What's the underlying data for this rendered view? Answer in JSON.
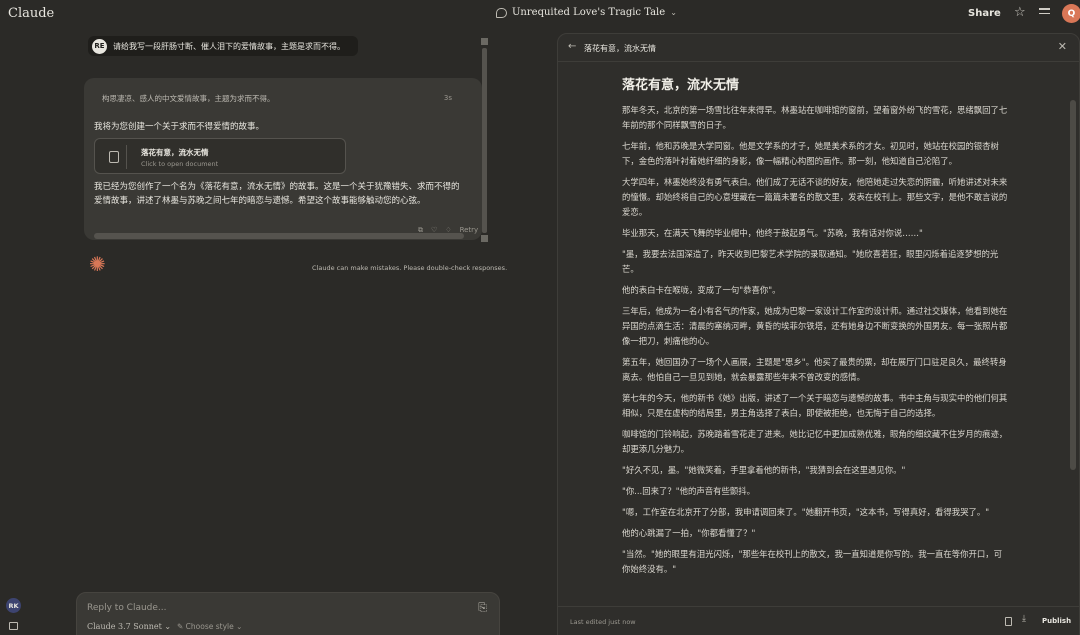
{
  "app": {
    "brand": "Claude"
  },
  "header": {
    "conversation_title": "Unrequited Love's Tragic Tale",
    "share_label": "Share",
    "user_initial": "Q"
  },
  "chat": {
    "user_initials": "RE",
    "user_message": "请给我写一段肝肠寸断、催人泪下的爱情故事，主题是求而不得。",
    "thinking_label": "构思凄凉、感人的中文爱情故事，主题为求而不得。",
    "thinking_time": "3s",
    "intro": "我将为您创建一个关于求而不得爱情的故事。",
    "artifact": {
      "title": "落花有意，流水无情",
      "subtitle": "Click to open document"
    },
    "summary": "我已经为您创作了一个名为《落花有意，流水无情》的故事。这是一个关于犹豫错失、求而不得的爱情故事，讲述了林墨与苏晚之间七年的暗恋与遗憾。希望这个故事能够触动您的心弦。",
    "actions": {
      "retry": "Retry"
    },
    "disclaimer": "Claude can make mistakes. Please double-check responses."
  },
  "composer": {
    "placeholder": "Reply to Claude...",
    "model": "Claude 3.7 Sonnet",
    "style": "Choose style"
  },
  "sidebar": {
    "user_initials": "RK"
  },
  "artifact_panel": {
    "header_title": "落花有意，流水无情",
    "doc_title": "落花有意，流水无情",
    "paragraphs": [
      "那年冬天，北京的第一场雪比往年来得早。林墨站在咖啡馆的窗前，望着窗外纷飞的雪花，思绪飘回了七年前的那个同样飘雪的日子。",
      "七年前，他和苏晚是大学同窗。他是文学系的才子，她是美术系的才女。初见时，她站在校园的银杏树下，金色的落叶衬着她纤细的身影，像一幅精心构图的画作。那一刻，他知道自己沦陷了。",
      "大学四年，林墨始终没有勇气表白。他们成了无话不谈的好友，他陪她走过失恋的阴霾，听她讲述对未来的憧憬。却始终将自己的心意埋藏在一篇篇未署名的散文里，发表在校刊上。那些文字，是他不敢言说的爱恋。",
      "毕业那天，在满天飞舞的毕业帽中，他终于鼓起勇气。\"苏晚，我有话对你说……\"",
      "\"墨，我要去法国深造了，昨天收到巴黎艺术学院的录取通知。\"她欣喜若狂，眼里闪烁着追逐梦想的光芒。",
      "他的表白卡在喉咙，变成了一句\"恭喜你\"。",
      "三年后，他成为一名小有名气的作家，她成为巴黎一家设计工作室的设计师。通过社交媒体，他看到她在异国的点滴生活：清晨的塞纳河畔，黄昏的埃菲尔铁塔，还有她身边不断变换的外国男友。每一张照片都像一把刀，刺痛他的心。",
      "第五年，她回国办了一场个人画展，主题是\"思乡\"。他买了最贵的票，却在展厅门口驻足良久，最终转身离去。他怕自己一旦见到她，就会暴露那些年来不曾改变的感情。",
      "第七年的今天，他的新书《她》出版，讲述了一个关于暗恋与遗憾的故事。书中主角与现实中的他们何其相似，只是在虚构的结局里，男主角选择了表白，即使被拒绝，也无悔于自己的选择。",
      "咖啡馆的门铃响起，苏晚踏着雪花走了进来。她比记忆中更加成熟优雅，眼角的细纹藏不住岁月的痕迹，却更添几分魅力。",
      "\"好久不见，墨。\"她微笑着，手里拿着他的新书，\"我猜到会在这里遇见你。\"",
      "\"你...回来了？\"他的声音有些颤抖。",
      "\"嗯，工作室在北京开了分部，我申请调回来了。\"她翻开书页，\"这本书，写得真好，看得我哭了。\"",
      "他的心跳漏了一拍，\"你都看懂了？\"",
      "\"当然。\"她的眼里有泪光闪烁，\"那些年在校刊上的散文，我一直知道是你写的。我一直在等你开口，可你始终没有。\""
    ],
    "footer": {
      "last_edited": "Last edited just now",
      "publish": "Publish"
    }
  }
}
